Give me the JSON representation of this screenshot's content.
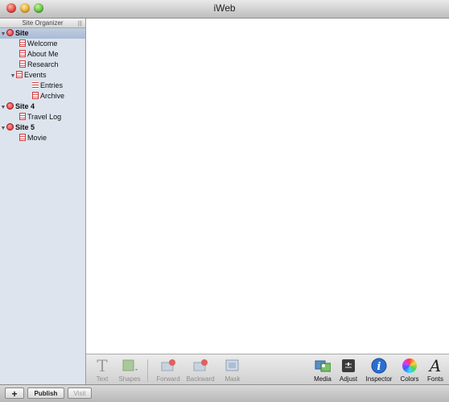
{
  "window": {
    "title": "iWeb"
  },
  "sidebar": {
    "header": "Site Organizer",
    "items": [
      {
        "label": "Site",
        "kind": "site"
      },
      {
        "label": "Welcome",
        "kind": "page"
      },
      {
        "label": "About Me",
        "kind": "page"
      },
      {
        "label": "Research",
        "kind": "page"
      },
      {
        "label": "Events",
        "kind": "page"
      },
      {
        "label": "Entries",
        "kind": "list"
      },
      {
        "label": "Archive",
        "kind": "page"
      },
      {
        "label": "Site 4",
        "kind": "site"
      },
      {
        "label": "Travel Log",
        "kind": "page"
      },
      {
        "label": "Site 5",
        "kind": "site"
      },
      {
        "label": "Movie",
        "kind": "page"
      }
    ]
  },
  "toolbar": {
    "text": "Text",
    "shapes": "Shapes",
    "forward": "Forward",
    "backward": "Backward",
    "mask": "Mask",
    "media": "Media",
    "adjust": "Adjust",
    "inspector": "Inspector",
    "colors": "Colors",
    "fonts": "Fonts"
  },
  "statusbar": {
    "add": "+",
    "publish": "Publish",
    "visit": "Visit"
  },
  "colors": {
    "selection": "#b3c3da",
    "sidebar_bg": "#dde4ee",
    "site_red": "#d62a2a"
  }
}
